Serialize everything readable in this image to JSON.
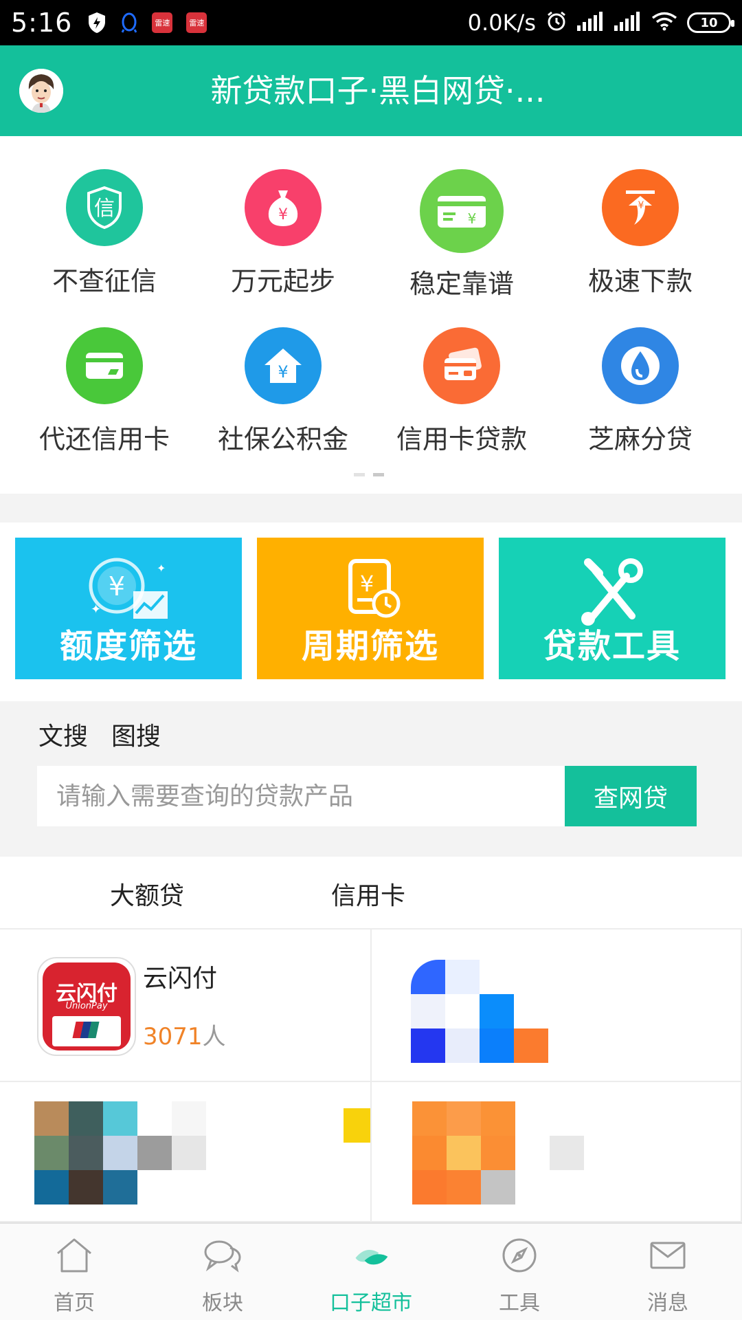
{
  "status_bar": {
    "time": "5:16",
    "network_speed": "0.0K/s",
    "battery": "10",
    "notification_app_label": "雷速"
  },
  "header": {
    "title": "新贷款口子·黑白网贷·..."
  },
  "categories": [
    {
      "label": "不查征信",
      "color": "#1fc59c",
      "icon": "shield-credit-icon"
    },
    {
      "label": "万元起步",
      "color": "#f8406b",
      "icon": "money-bag-icon"
    },
    {
      "label": "稳定靠谱",
      "color": "#6cd24b",
      "icon": "card-yuan-icon"
    },
    {
      "label": "极速下款",
      "color": "#fb6a21",
      "icon": "fast-download-icon"
    },
    {
      "label": "代还信用卡",
      "color": "#49c83a",
      "icon": "credit-card-icon"
    },
    {
      "label": "社保公积金",
      "color": "#1f9ae8",
      "icon": "house-yuan-icon"
    },
    {
      "label": "信用卡贷款",
      "color": "#fa6b35",
      "icon": "cards-icon"
    },
    {
      "label": "芝麻分贷",
      "color": "#2f86e4",
      "icon": "sesame-drop-icon"
    }
  ],
  "banners": [
    {
      "label": "额度筛选",
      "color": "#1bc2ee",
      "icon": "amount-chart-icon"
    },
    {
      "label": "周期筛选",
      "color": "#ffb000",
      "icon": "calendar-clock-icon"
    },
    {
      "label": "贷款工具",
      "color": "#16d1b6",
      "icon": "wrench-tools-icon"
    }
  ],
  "search": {
    "tabs": [
      "文搜",
      "图搜"
    ],
    "placeholder": "请输入需要查询的贷款产品",
    "button_label": "查网贷"
  },
  "product_tabs": [
    "大额贷",
    "信用卡"
  ],
  "products": [
    {
      "name": "云闪付",
      "count": "3071",
      "count_unit": "人",
      "logo_text": "云闪付",
      "logo_subtext": "UnionPay"
    }
  ],
  "bottom_nav": [
    {
      "label": "首页",
      "icon": "home-icon",
      "active": false
    },
    {
      "label": "板块",
      "icon": "chat-bubbles-icon",
      "active": false
    },
    {
      "label": "口子超市",
      "icon": "market-icon",
      "active": true
    },
    {
      "label": "工具",
      "icon": "compass-icon",
      "active": false
    },
    {
      "label": "消息",
      "icon": "mail-icon",
      "active": false
    }
  ],
  "colors": {
    "brand": "#14c09b",
    "highlight_number": "#f08328"
  }
}
